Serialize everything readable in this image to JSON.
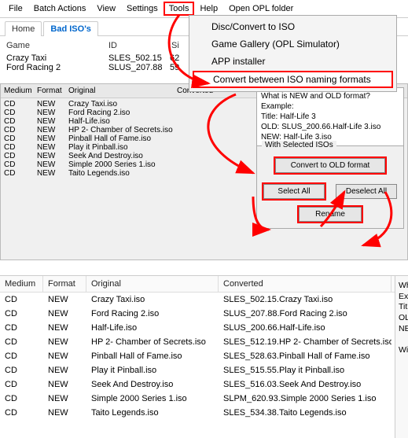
{
  "menubar": {
    "items": [
      "File",
      "Batch Actions",
      "View",
      "Settings",
      "Tools",
      "Help",
      "Open OPL folder"
    ]
  },
  "tabs": {
    "home": "Home",
    "bad": "Bad ISO's"
  },
  "list_top": {
    "headers": [
      "Game",
      "ID",
      "Si"
    ],
    "rows": [
      {
        "game": "Crazy Taxi",
        "id": "SLES_502.15",
        "siz": "62"
      },
      {
        "game": "Ford Racing 2",
        "id": "SLUS_207.88",
        "siz": "59"
      }
    ]
  },
  "dropdown": {
    "items": [
      "Disc/Convert to ISO",
      "Game Gallery (OPL Simulator)",
      "APP installer",
      "Convert between ISO naming formats"
    ]
  },
  "mid": {
    "headers": [
      "Medium",
      "Format",
      "Original",
      "Converted"
    ],
    "rows": [
      {
        "m": "CD",
        "f": "NEW",
        "o": "Crazy Taxi.iso",
        "c": ""
      },
      {
        "m": "CD",
        "f": "NEW",
        "o": "Ford Racing 2.iso",
        "c": ""
      },
      {
        "m": "CD",
        "f": "NEW",
        "o": "Half-Life.iso",
        "c": ""
      },
      {
        "m": "CD",
        "f": "NEW",
        "o": "HP 2- Chamber of Secrets.iso",
        "c": ""
      },
      {
        "m": "CD",
        "f": "NEW",
        "o": "Pinball Hall of Fame.iso",
        "c": ""
      },
      {
        "m": "CD",
        "f": "NEW",
        "o": "Play it Pinball.iso",
        "c": ""
      },
      {
        "m": "CD",
        "f": "NEW",
        "o": "Seek And Destroy.iso",
        "c": ""
      },
      {
        "m": "CD",
        "f": "NEW",
        "o": "Simple 2000 Series 1.iso",
        "c": ""
      },
      {
        "m": "CD",
        "f": "NEW",
        "o": "Taito Legends.iso",
        "c": ""
      }
    ]
  },
  "info": {
    "l1": "What is NEW and OLD format?",
    "l2": "Example:",
    "l3": "Title: Half-Life 3",
    "l4": "OLD: SLUS_200.66.Half-Life 3.iso",
    "l5": "NEW: Half-Life 3.iso"
  },
  "groupbox": {
    "title": "With Selected ISOs",
    "convert_old": "Convert to OLD format",
    "select_all": "Select All",
    "deselect_all": "Deselect All",
    "rename": "Rename"
  },
  "bottom": {
    "headers": [
      "Medium",
      "Format",
      "Original",
      "Converted"
    ],
    "rows": [
      {
        "m": "CD",
        "f": "NEW",
        "o": "Crazy Taxi.iso",
        "c": "SLES_502.15.Crazy Taxi.iso"
      },
      {
        "m": "CD",
        "f": "NEW",
        "o": "Ford Racing 2.iso",
        "c": "SLUS_207.88.Ford Racing 2.iso"
      },
      {
        "m": "CD",
        "f": "NEW",
        "o": "Half-Life.iso",
        "c": "SLUS_200.66.Half-Life.iso"
      },
      {
        "m": "CD",
        "f": "NEW",
        "o": "HP 2- Chamber of Secrets.iso",
        "c": "SLES_512.19.HP 2- Chamber of Secrets.iso"
      },
      {
        "m": "CD",
        "f": "NEW",
        "o": "Pinball Hall of Fame.iso",
        "c": "SLES_528.63.Pinball Hall of Fame.iso"
      },
      {
        "m": "CD",
        "f": "NEW",
        "o": "Play it Pinball.iso",
        "c": "SLES_515.55.Play it Pinball.iso"
      },
      {
        "m": "CD",
        "f": "NEW",
        "o": "Seek And Destroy.iso",
        "c": "SLES_516.03.Seek And Destroy.iso"
      },
      {
        "m": "CD",
        "f": "NEW",
        "o": "Simple 2000 Series 1.iso",
        "c": "SLPM_620.93.Simple 2000 Series 1.iso"
      },
      {
        "m": "CD",
        "f": "NEW",
        "o": "Taito Legends.iso",
        "c": "SLES_534.38.Taito Legends.iso"
      }
    ]
  },
  "side_info": {
    "l1": "What i",
    "l2": "Exam",
    "l3": "Title: H",
    "l4": "OLD: S",
    "l5": "NEW:",
    "l6": "With S"
  }
}
